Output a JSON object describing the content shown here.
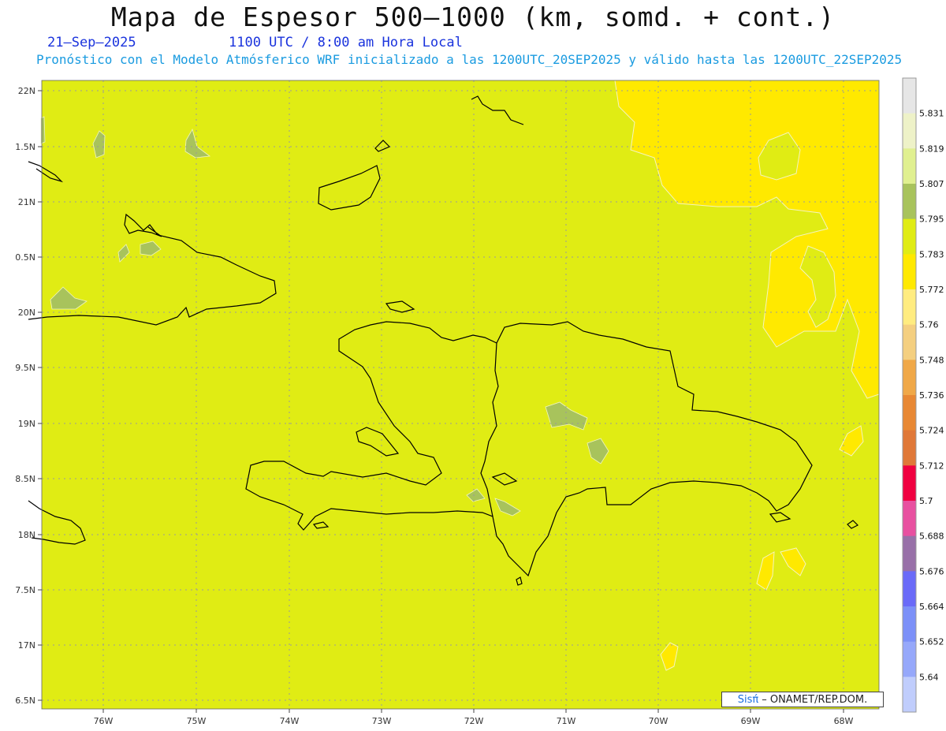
{
  "header": {
    "title": "Mapa de Espesor 500–1000 (km, somd. + cont.)",
    "date": "21–Sep–2025",
    "time": "1100 UTC / 8:00 am Hora Local",
    "description": "Pronóstico con el Modelo Atmósferico WRF inicializado a las 1200UTC_20SEP2025 y válido hasta las  1200UTC_22SEP2025"
  },
  "map": {
    "lat_labels": [
      "22N",
      "1.5N",
      "21N",
      "0.5N",
      "20N",
      "9.5N",
      "19N",
      "8.5N",
      "18N",
      "7.5N",
      "17N",
      "6.5N"
    ],
    "lon_labels": [
      "76W",
      "75W",
      "74W",
      "73W",
      "72W",
      "71W",
      "70W",
      "69W",
      "68W"
    ],
    "field_colors": {
      "base": "#e0ec14",
      "high": "#ffe900",
      "low": "#a8c35c"
    }
  },
  "colorbar": {
    "levels": [
      "5.831",
      "5.819",
      "5.807",
      "5.795",
      "5.783",
      "5.772",
      "5.76",
      "5.748",
      "5.736",
      "5.724",
      "5.712",
      "5.7",
      "5.688",
      "5.676",
      "5.664",
      "5.652",
      "5.64"
    ],
    "colors": [
      "#e6e6e6",
      "#eef2c8",
      "#e0f090",
      "#a8c35c",
      "#e0ec14",
      "#ffe900",
      "#ffec80",
      "#f4cf80",
      "#f0a848",
      "#e88834",
      "#e07838",
      "#f00040",
      "#e850a0",
      "#9870a8",
      "#6a6af8",
      "#7c90f8",
      "#96a8fa",
      "#c0cdfc"
    ]
  },
  "credit": {
    "sis": "Sisπ́",
    "org": "– ONAMET/REP.DOM."
  }
}
